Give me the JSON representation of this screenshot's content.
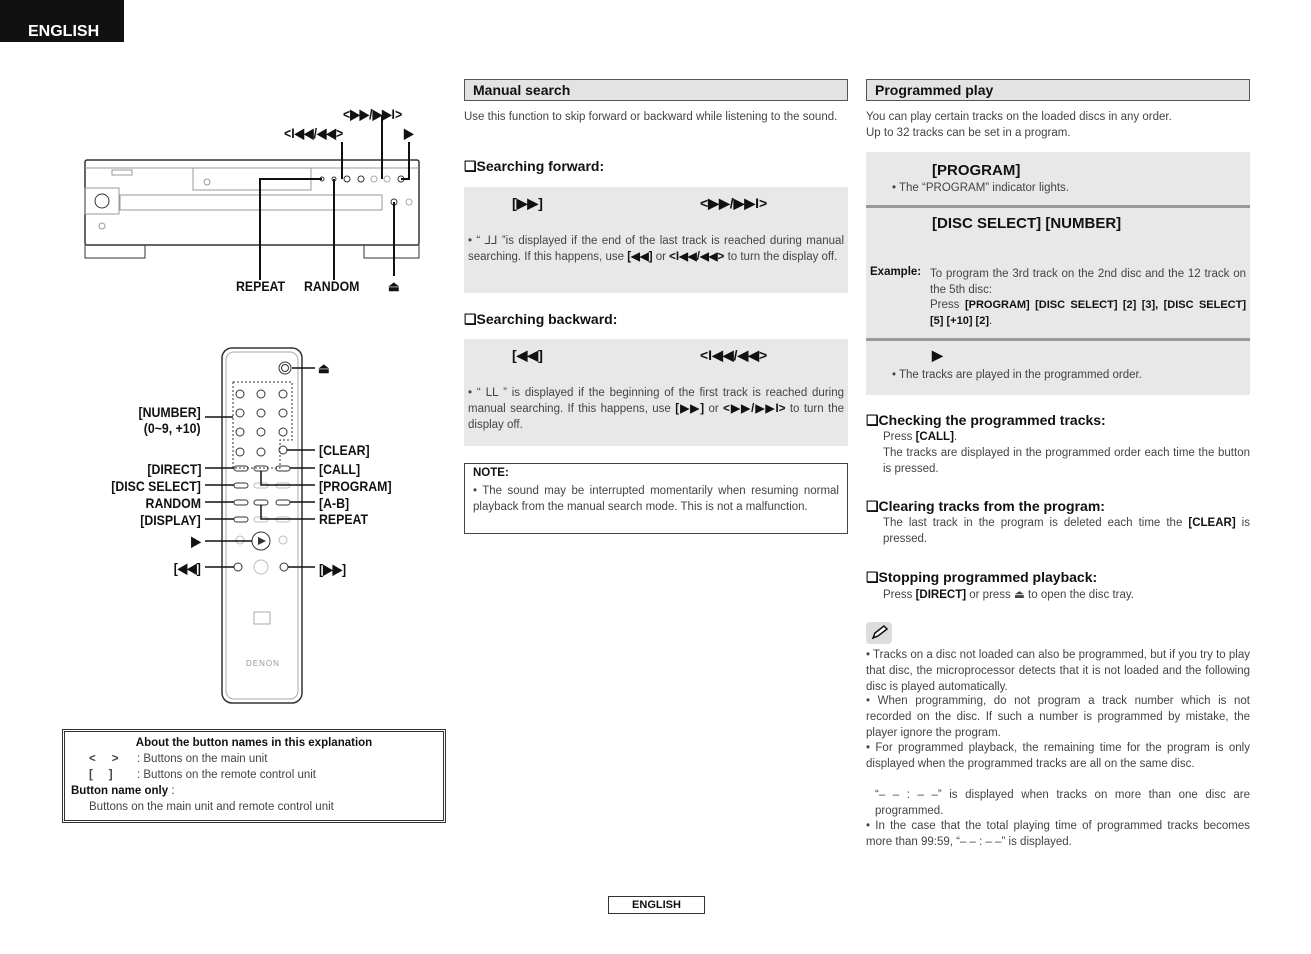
{
  "tab": "ENGLISH",
  "footer": "ENGLISH",
  "unit_labels": {
    "fwd": "<▶▶/▶▶I>",
    "back": "<I◀◀/◀◀>",
    "play": "▶",
    "repeat": "REPEAT",
    "random": "RANDOM",
    "eject": "⏏",
    "brand": "DENON"
  },
  "remote_labels": {
    "eject": "⏏",
    "number": "[NUMBER]",
    "number_range": "(0~9, +10)",
    "clear": "[CLEAR]",
    "direct": "[DIRECT]",
    "call": "[CALL]",
    "disc_select": "[DISC SELECT]",
    "program": "[PROGRAM]",
    "random": "RANDOM",
    "ab": "[A-B]",
    "display": "[DISPLAY]",
    "repeat": "REPEAT",
    "play": "▶",
    "rew": "[◀◀]",
    "ff": "[▶▶]",
    "brand": "DENON"
  },
  "legend": {
    "title": "About the button names in this explanation",
    "row1_sym": "<     >",
    "row1": ": Buttons on the main unit",
    "row2_sym": "[     ]",
    "row2": ": Buttons on the remote control unit",
    "row3_b": "Button name only",
    "row3": " :",
    "row4": "Buttons on the main unit and remote control unit"
  },
  "manual": {
    "title": "Manual search",
    "intro": "Use this function to skip forward or backward while listening to the sound.",
    "fwd_title": "❑Searching forward:",
    "fwd_remote": "[▶▶]",
    "fwd_unit": "<▶▶/▶▶I>",
    "fwd_note_a": "• “ ⅃⅃ ”is displayed if the end of the last track is reached during manual searching. If this happens, use ",
    "fwd_note_b": "[◀◀]",
    "fwd_note_c": " or ",
    "fwd_note_d": "<I◀◀/◀◀>",
    "fwd_note_e": " to turn the display off.",
    "back_title": "❑Searching backward:",
    "back_remote": "[◀◀]",
    "back_unit": "<I◀◀/◀◀>",
    "back_note_a": "• “ ᒪᒪ ” is displayed if the beginning of the first track is reached during manual searching. If this happens, use ",
    "back_note_b": "[▶▶]",
    "back_note_c": " or ",
    "back_note_d": "<▶▶/▶▶I>",
    "back_note_e": " to turn the display off.",
    "note_title": "NOTE:",
    "note_text": "• The sound may be interrupted momentarily when resuming normal playback from the manual search mode. This is not a malfunction."
  },
  "program": {
    "title": "Programmed play",
    "intro1": "You can play certain tracks on the loaded discs in any order.",
    "intro2": "Up to 32 tracks can be set in a program.",
    "step1_key": "[PROGRAM]",
    "step1_note": "• The “PROGRAM” indicator lights.",
    "step2_key": "[DISC SELECT]  [NUMBER]",
    "example_label": "Example:",
    "example_text": "To program the 3rd track on the 2nd disc and the 12 track on the 5th disc:",
    "example_press": "Press ",
    "example_keys": "[PROGRAM] [DISC SELECT] [2] [3], [DISC SELECT] [5] [+10] [2]",
    "step3_key": "▶",
    "step3_note": "• The tracks are played in the programmed order.",
    "check_title": "❑Checking the programmed tracks:",
    "check_press": "Press ",
    "check_key": "[CALL]",
    "check_text": "The tracks are displayed in the programmed order each time the button is pressed.",
    "clear_title": "❑Clearing tracks from the program:",
    "clear_a": "The last track in the program is deleted each time the ",
    "clear_key": "[CLEAR]",
    "clear_b": " is pressed.",
    "stop_title": "❑Stopping programmed playback:",
    "stop_a": "Press ",
    "stop_key": "[DIRECT]",
    "stop_b": " or press ⏏ to open the disc tray.",
    "notes": [
      "• Tracks on a disc not loaded can also be programmed, but if you try to play that disc, the microprocessor detects that it is not loaded and the following disc is played automatically.",
      "• When programming, do not program a track number which is not recorded on the disc. If such a number is programmed by mistake, the player ignore the program.",
      "• For programmed playback, the remaining time for the program is only displayed when the programmed tracks are all on the same disc.",
      "“– – : – –” is displayed when tracks on more than one disc are programmed.",
      "• In the case that the total playing time of programmed tracks becomes more than 99:59, “– – : – –” is displayed."
    ]
  }
}
